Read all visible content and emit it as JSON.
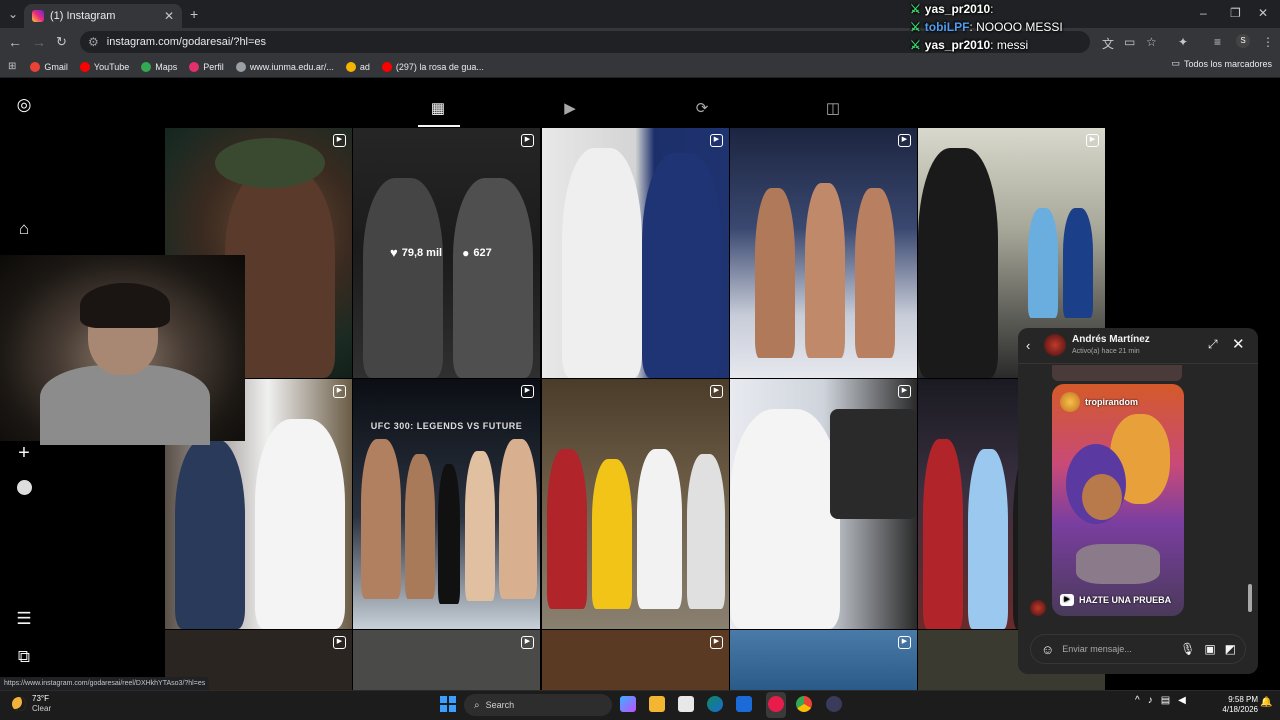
{
  "browser": {
    "tab_title": "(1) Instagram",
    "url": "instagram.com/godaresai/?hl=es",
    "bookmarks": [
      {
        "label": "Gmail",
        "color": "#ea4335"
      },
      {
        "label": "YouTube",
        "color": "#ff0000"
      },
      {
        "label": "Maps",
        "color": "#34a853"
      },
      {
        "label": "Perfil",
        "color": "#e1306c"
      },
      {
        "label": "www.iunma.edu.ar/...",
        "color": "#9aa0a6"
      },
      {
        "label": "ad",
        "color": "#f4b400"
      },
      {
        "label": "(297) la rosa de gua...",
        "color": "#ff0000"
      }
    ],
    "all_bookmarks": "Todos los marcadores",
    "status_url": "https://www.instagram.com/godaresai/reel/DXHkhYTAso3/?hl=es"
  },
  "stream_chat": [
    {
      "user": "yas_pr2010",
      "msg": ":",
      "color": "#ffffff"
    },
    {
      "user": "tobiLPF",
      "msg": ": NOOOO MESSI",
      "color": "#4f9cf0"
    },
    {
      "user": "yas_pr2010",
      "msg": ": messi",
      "color": "#ffffff"
    }
  ],
  "profile": {
    "hover_stats": {
      "likes": "79,8 mil",
      "comments": "627"
    },
    "tile_caption": "UFC 300: LEGENDS VS FUTURE"
  },
  "dm": {
    "name": "Andrés Martínez",
    "status": "Activo(a) hace 21 min",
    "shared_user": "tropirandom",
    "cta": "HAZTE UNA PRUEBA",
    "input_placeholder": "Enviar mensaje..."
  },
  "taskbar": {
    "temp": "73°F",
    "condition": "Clear",
    "search": "Search",
    "time": "9:58 PM",
    "date": "4/18/2026"
  }
}
